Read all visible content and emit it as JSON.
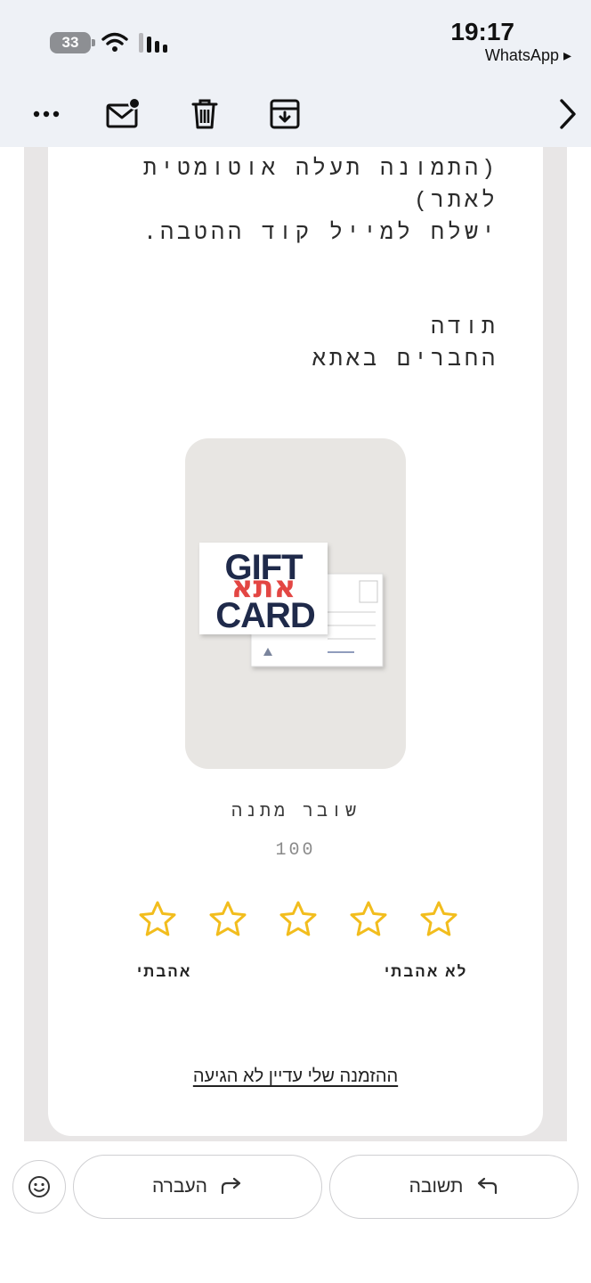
{
  "status_bar": {
    "battery": "33",
    "time": "19:17",
    "back_app": "WhatsApp ▸"
  },
  "toolbar": {
    "icons": [
      "more-icon",
      "mark-unread-icon",
      "trash-icon",
      "archive-icon",
      "chevron-right-icon"
    ]
  },
  "email": {
    "paragraph_lines": [
      "(התמונה תעלה אוטומטית",
      "לאתר)",
      "ישלח למייל קוד ההטבה."
    ],
    "signature_lines": [
      "תודה",
      "החברים באתא"
    ],
    "product": {
      "card_top_text": "GIFT",
      "card_hebrew_text": "אתא",
      "card_bottom_text": "CARD",
      "name": "שובר מתנה",
      "price": "100"
    },
    "rating": {
      "stars": 5,
      "star_color": "#f2bd1d",
      "low_label": "לא אהבתי",
      "high_label": "אהבתי"
    },
    "order_link": "ההזמנה שלי עדיין לא הגיעה"
  },
  "actions": {
    "reply_label": "תשובה",
    "forward_label": "העברה",
    "emoji_icon": "smiley-icon"
  },
  "colors": {
    "toolbar_bg": "#eef1f6",
    "frame_bg": "#e8e6e6",
    "brand_navy": "#1f2a4a",
    "brand_red": "#e0322f"
  }
}
